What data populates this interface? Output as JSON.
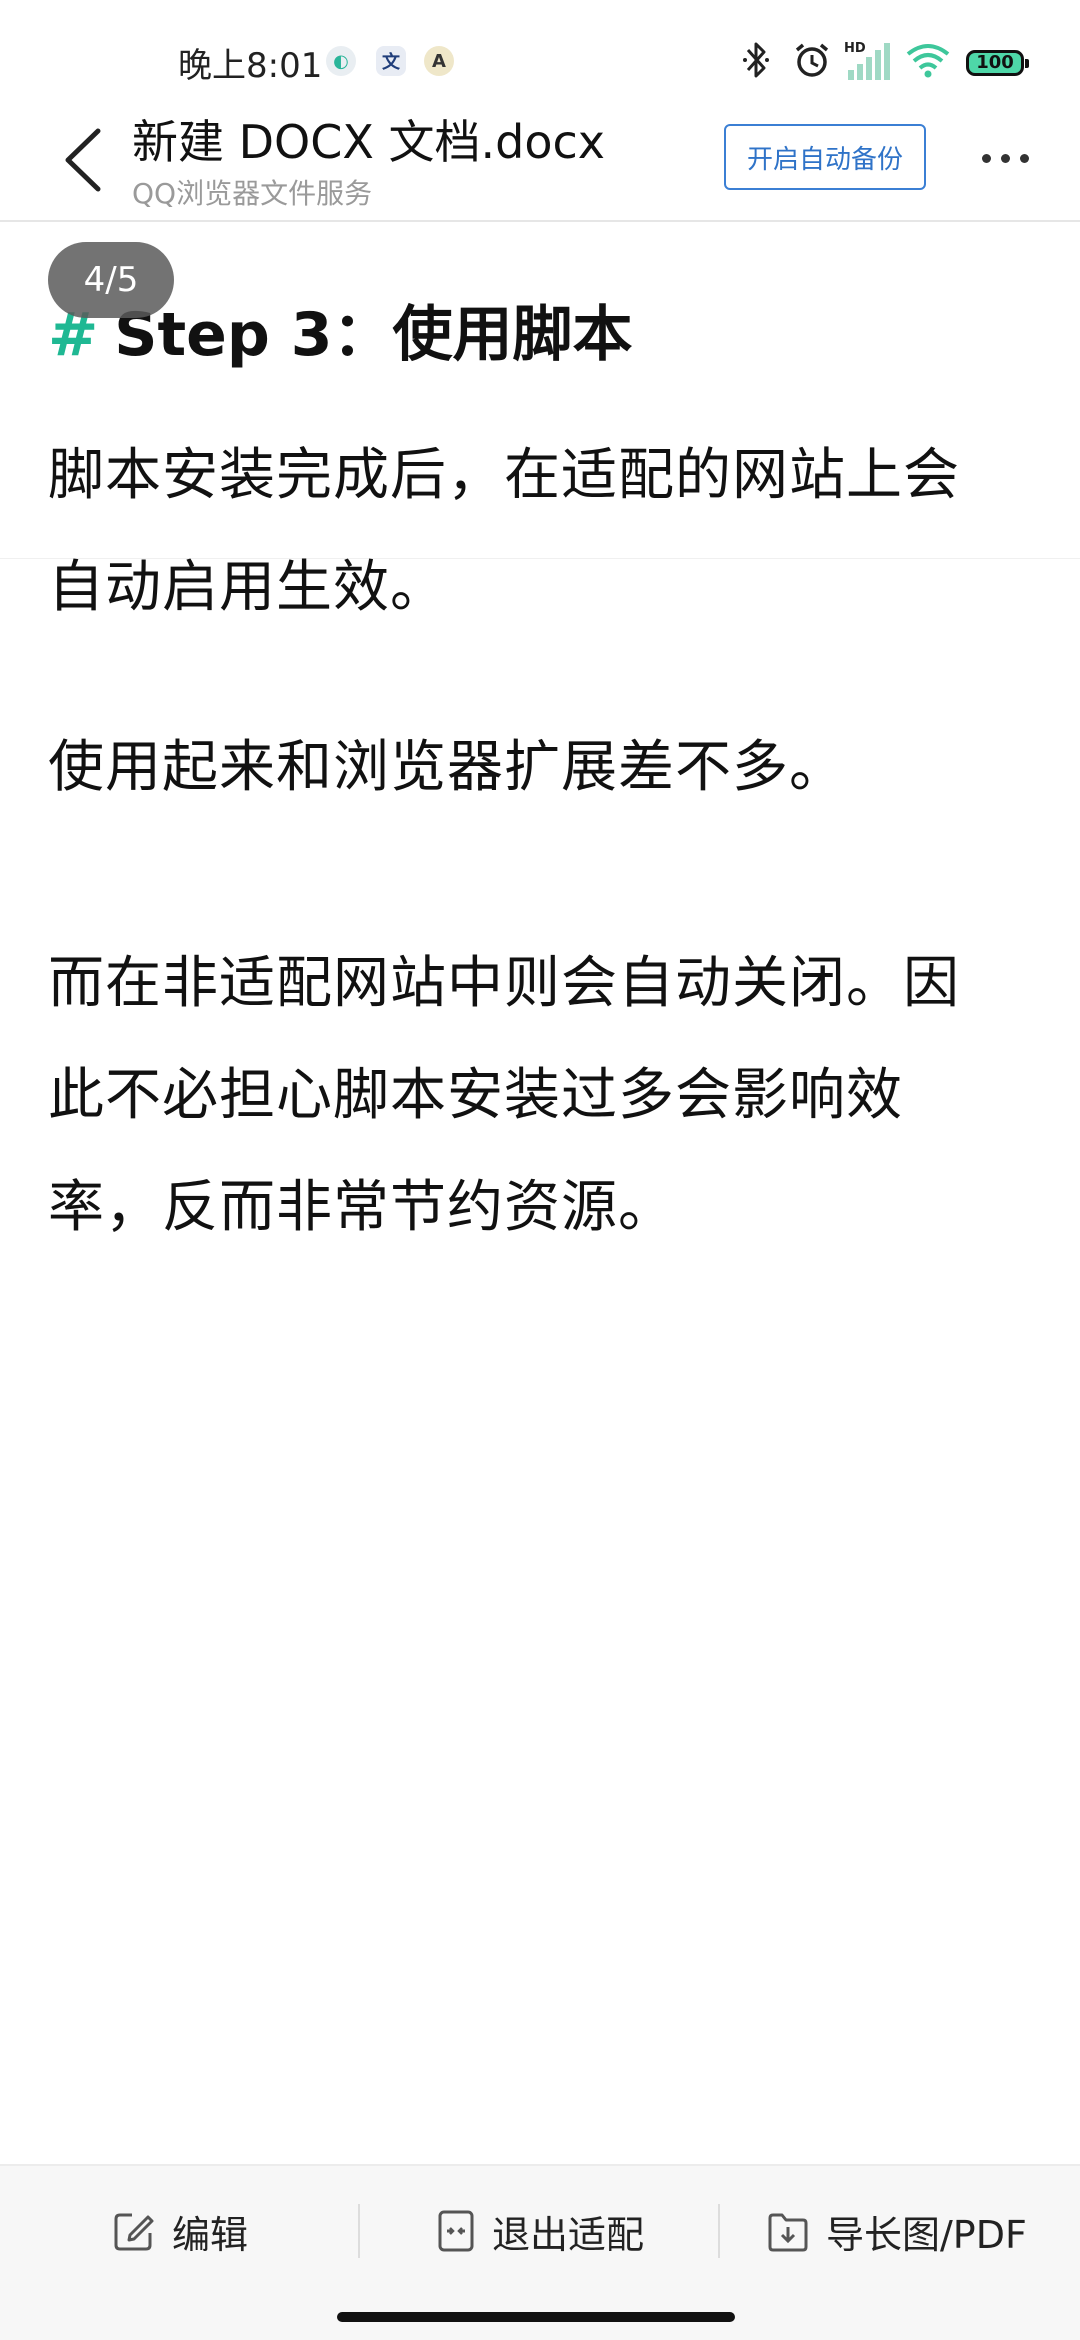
{
  "status_bar": {
    "time": "晚上8:01",
    "notification_icons": [
      "app-icon",
      "translate-icon",
      "app-icon"
    ],
    "signal_label": "HD",
    "battery_level": "100"
  },
  "header": {
    "title": "新建 DOCX 文档.docx",
    "subtitle": "QQ浏览器文件服务",
    "backup_button": "开启自动备份"
  },
  "document": {
    "page_indicator": "4/5",
    "heading_marker": "#",
    "heading": "Step 3：使用脚本",
    "paragraphs": [
      [
        "脚本安装完成后，在适配的网站上会",
        "自动启用生效。"
      ],
      [
        "使用起来和浏览器扩展差不多。"
      ],
      [
        "而在非适配网站中则会自动关闭。因",
        "此不必担心脚本安装过多会影响效",
        "率，反而非常节约资源。"
      ]
    ]
  },
  "toolbar": {
    "edit": "编辑",
    "exit_fit": "退出适配",
    "export": "导长图/PDF"
  },
  "colors": {
    "accent_green": "#1fb893",
    "button_blue": "#2f73c8",
    "battery_green": "#4ed7a8"
  }
}
